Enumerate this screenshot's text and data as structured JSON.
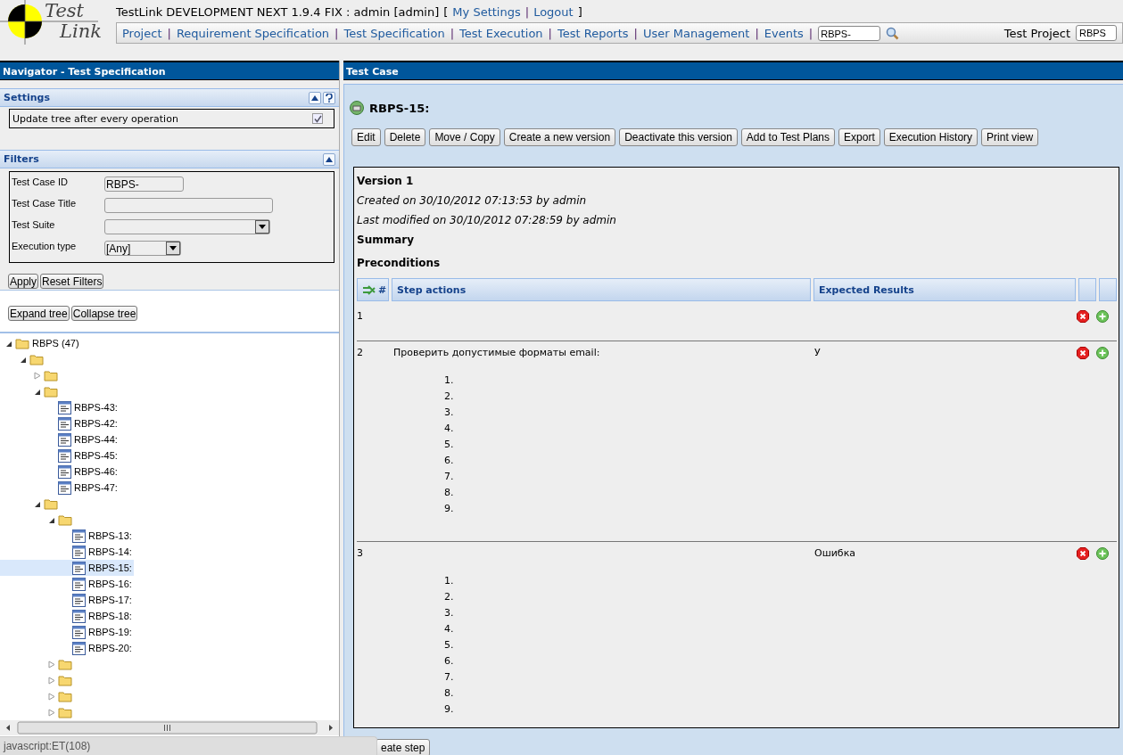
{
  "header": {
    "logo": {
      "line1": "Test",
      "line2": "Link"
    },
    "top_line": [
      {
        "kind": "text",
        "label": "TestLink DEVELOPMENT NEXT 1.9.4 FIX : admin [admin]"
      },
      {
        "kind": "text",
        "label": "["
      },
      {
        "kind": "link",
        "label": "My Settings"
      },
      {
        "kind": "separator",
        "label": "|"
      },
      {
        "kind": "link",
        "label": "Logout"
      },
      {
        "kind": "text",
        "label": "]"
      }
    ],
    "nav": [
      {
        "kind": "link",
        "label": "Project"
      },
      {
        "kind": "separator",
        "label": "|"
      },
      {
        "kind": "link",
        "label": "Requirement Specification"
      },
      {
        "kind": "separator",
        "label": "|"
      },
      {
        "kind": "link",
        "label": "Test Specification"
      },
      {
        "kind": "separator",
        "label": "|"
      },
      {
        "kind": "link",
        "label": "Test Execution"
      },
      {
        "kind": "separator",
        "label": "|"
      },
      {
        "kind": "link",
        "label": "Test Reports"
      },
      {
        "kind": "separator",
        "label": "|"
      },
      {
        "kind": "link",
        "label": "User Management"
      },
      {
        "kind": "separator",
        "label": "|"
      },
      {
        "kind": "link",
        "label": "Events"
      },
      {
        "kind": "separator",
        "label": "|"
      }
    ],
    "search": {
      "value": "RBPS-"
    },
    "project": {
      "label": "Test Project",
      "value": "RBPS"
    }
  },
  "navigator": {
    "title": "Navigator - Test Specification",
    "settings": {
      "title": "Settings",
      "option": {
        "label": "Update tree after every operation",
        "checked": true
      }
    },
    "filters": {
      "title": "Filters",
      "fields": [
        {
          "kind": "text",
          "label": "Test Case ID",
          "value": "RBPS-"
        },
        {
          "kind": "text",
          "label": "Test Case Title"
        },
        {
          "kind": "select",
          "label": "Test Suite"
        },
        {
          "kind": "select",
          "label": "Execution type",
          "value": "[Any]"
        }
      ],
      "buttons": [
        "Apply",
        "Reset Filters"
      ]
    },
    "tree_buttons": [
      "Expand tree",
      "Collapse tree"
    ],
    "tree": [
      {
        "kind": "folder",
        "label": "RBPS (47)",
        "expanded": true,
        "selected": false,
        "children": [
          {
            "kind": "folder",
            "expanded": true,
            "selected": false,
            "children": [
              {
                "kind": "folder",
                "expanded": false,
                "selected": false
              },
              {
                "kind": "folder",
                "expanded": true,
                "selected": false,
                "children": [
                  {
                    "kind": "testcase",
                    "label": "RBPS-43:",
                    "selected": false
                  },
                  {
                    "kind": "testcase",
                    "label": "RBPS-42:",
                    "selected": false
                  },
                  {
                    "kind": "testcase",
                    "label": "RBPS-44:",
                    "selected": false
                  },
                  {
                    "kind": "testcase",
                    "label": "RBPS-45:",
                    "selected": false
                  },
                  {
                    "kind": "testcase",
                    "label": "RBPS-46:",
                    "selected": false
                  },
                  {
                    "kind": "testcase",
                    "label": "RBPS-47:",
                    "selected": false
                  }
                ]
              },
              {
                "kind": "folder",
                "expanded": true,
                "selected": false,
                "children": [
                  {
                    "kind": "folder",
                    "expanded": true,
                    "selected": false,
                    "children": [
                      {
                        "kind": "testcase",
                        "label": "RBPS-13:",
                        "selected": false
                      },
                      {
                        "kind": "testcase",
                        "label": "RBPS-14:",
                        "selected": false
                      },
                      {
                        "kind": "testcase",
                        "label": "RBPS-15:",
                        "selected": true
                      },
                      {
                        "kind": "testcase",
                        "label": "RBPS-16:",
                        "selected": false
                      },
                      {
                        "kind": "testcase",
                        "label": "RBPS-17:",
                        "selected": false
                      },
                      {
                        "kind": "testcase",
                        "label": "RBPS-18:",
                        "selected": false
                      },
                      {
                        "kind": "testcase",
                        "label": "RBPS-19:",
                        "selected": false
                      },
                      {
                        "kind": "testcase",
                        "label": "RBPS-20:",
                        "selected": false
                      }
                    ]
                  },
                  {
                    "kind": "folder",
                    "expanded": false,
                    "selected": false
                  },
                  {
                    "kind": "folder",
                    "expanded": false,
                    "selected": false
                  },
                  {
                    "kind": "folder",
                    "expanded": false,
                    "selected": false
                  },
                  {
                    "kind": "folder",
                    "expanded": false,
                    "selected": false
                  }
                ]
              }
            ]
          }
        ]
      }
    ]
  },
  "test_case": {
    "title": "Test Case",
    "name": "RBPS-15:",
    "buttons": [
      "Edit",
      "Delete",
      "Move / Copy",
      "Create a new version",
      "Deactivate this version",
      "Add to Test Plans",
      "Export",
      "Execution History",
      "Print view"
    ],
    "version": "Version 1",
    "created": "Created on 30/10/2012 07:13:53  by admin",
    "modified": "Last modified on  30/10/2012 07:28:59  by admin",
    "summary": "Summary",
    "preconditions": "Preconditions",
    "columns": [
      "#",
      "Step actions",
      "Expected Results"
    ],
    "steps": [
      {
        "number": "1"
      },
      {
        "number": "2",
        "action": "Проверить допустимые форматы email:",
        "items": [
          "1.",
          "2.",
          "3.",
          "4.",
          "5.",
          "6.",
          "7.",
          "8.",
          "9."
        ],
        "expected": "У"
      },
      {
        "number": "3",
        "items": [
          "1.",
          "2.",
          "3.",
          "4.",
          "5.",
          "6.",
          "7.",
          "8.",
          "9."
        ],
        "expected": "Ошибка"
      }
    ],
    "bottom_button": "eate step"
  },
  "status_bar": "javascript:ET(108)"
}
